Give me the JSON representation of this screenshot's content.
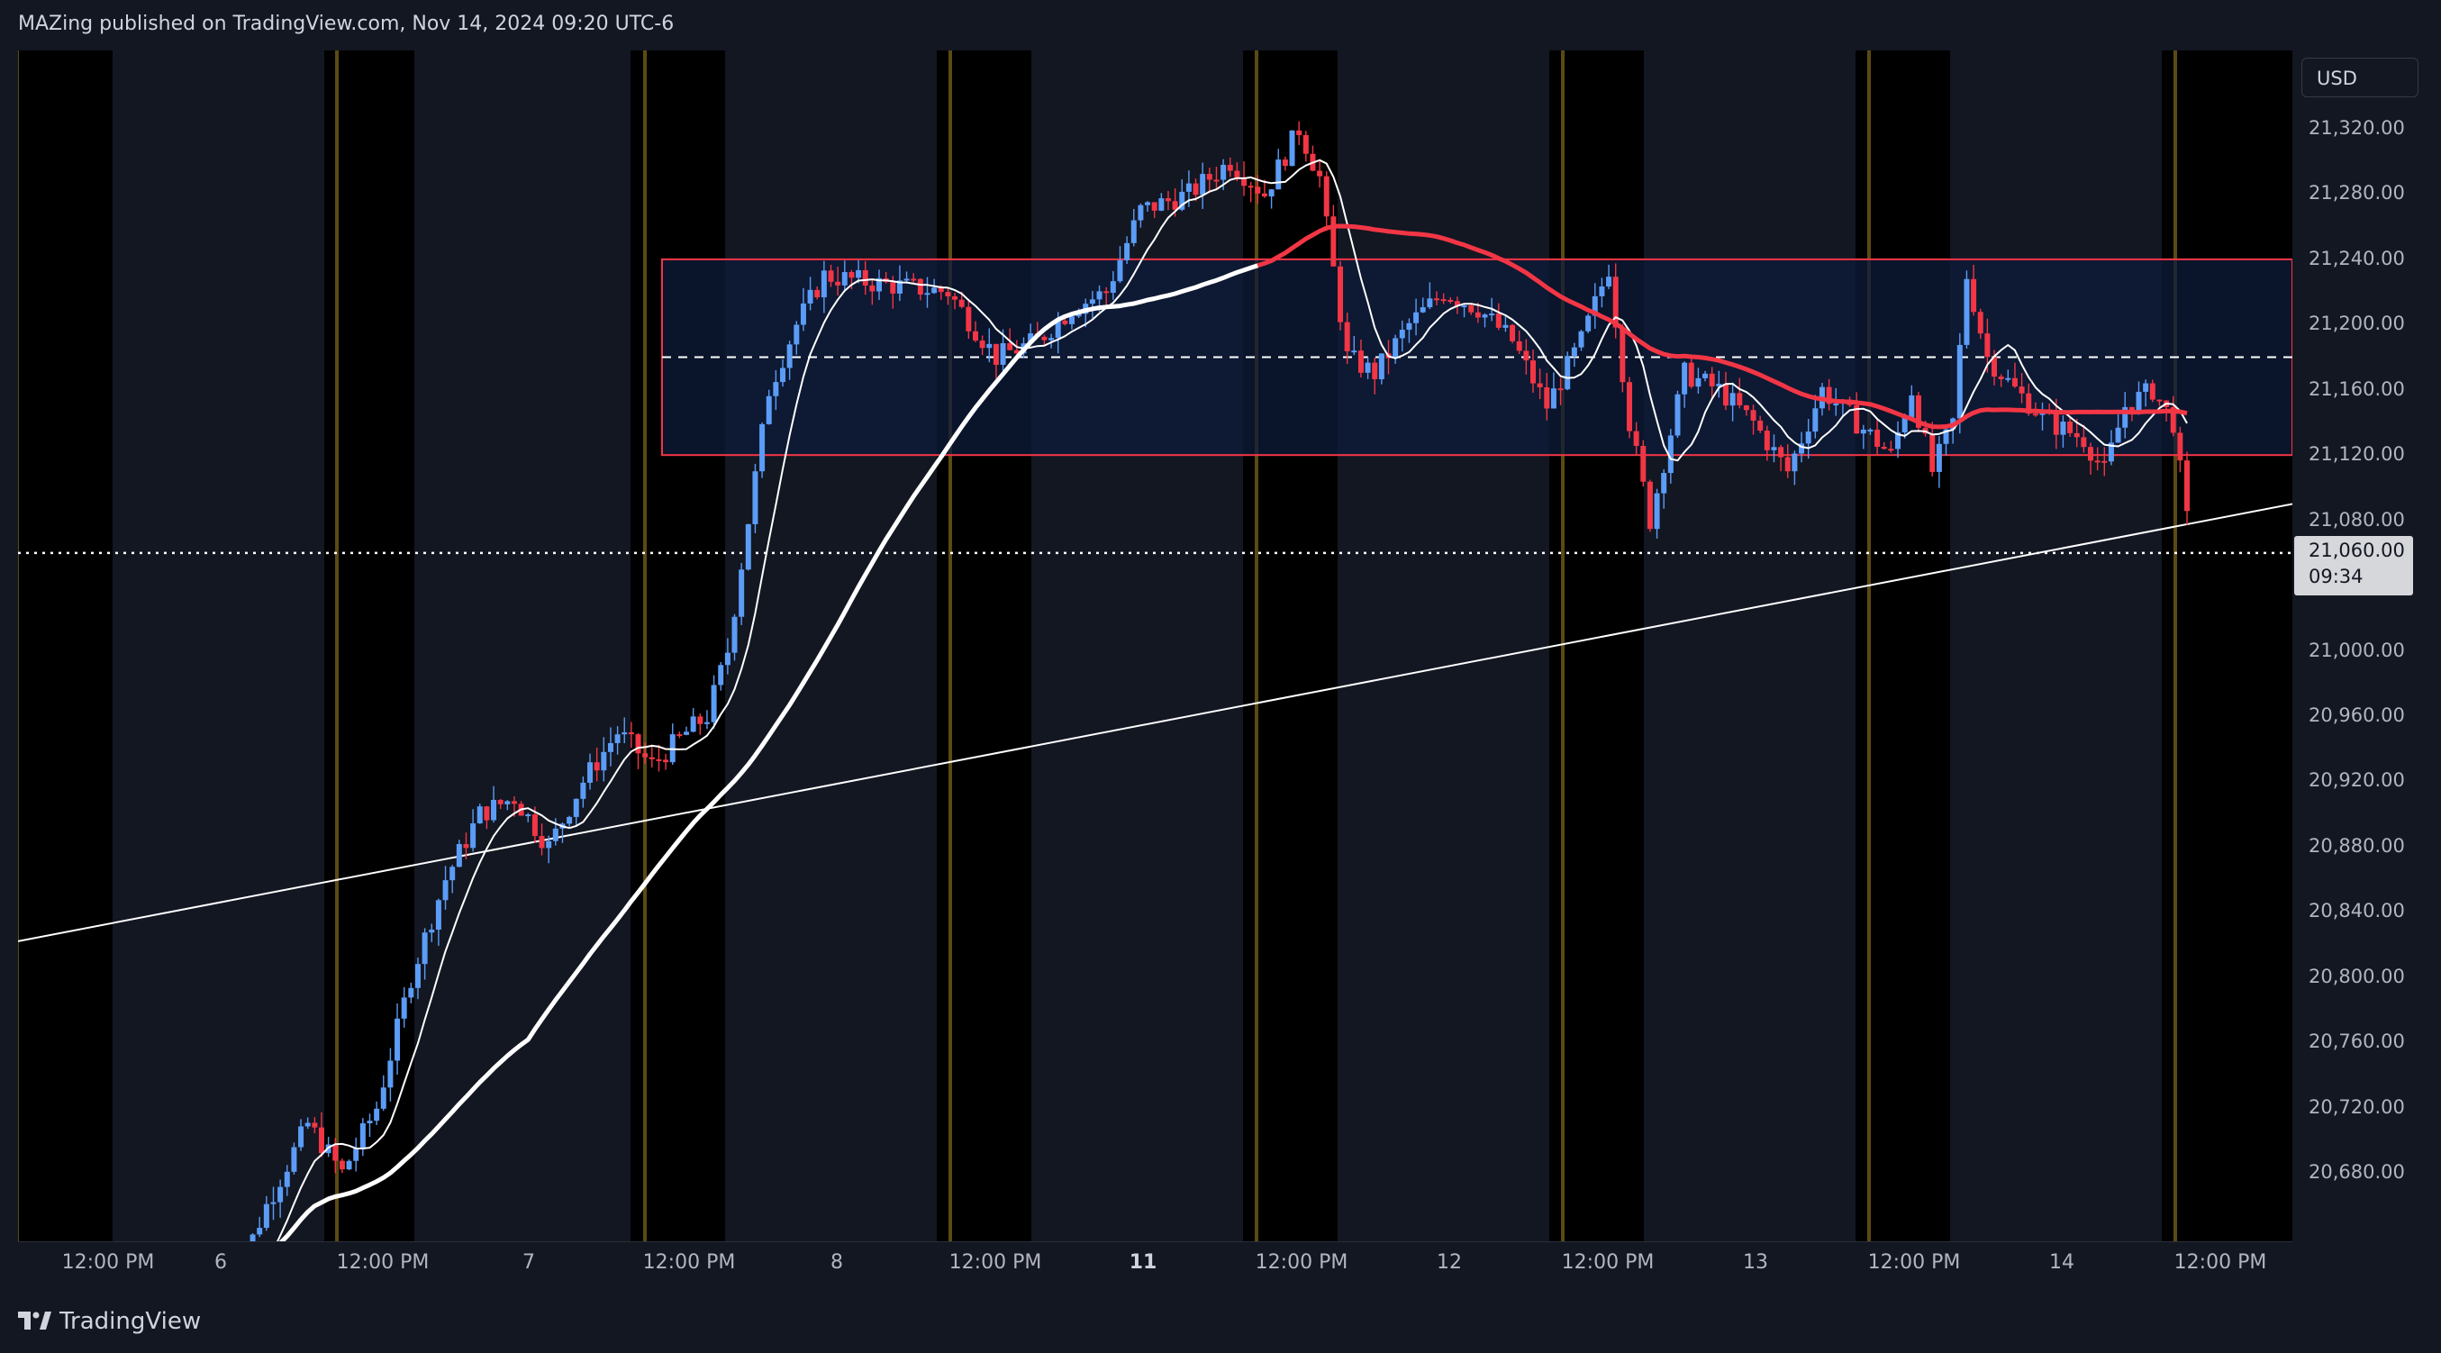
{
  "header": {
    "publisher_text": "MAZing published on TradingView.com, Nov 14, 2024 09:20 UTC-6"
  },
  "footer": {
    "logo_text": "TradingView"
  },
  "price_axis": {
    "currency": "USD"
  },
  "current_price": {
    "value": "21,060.00",
    "countdown": "09:34"
  },
  "colors": {
    "background": "#131722",
    "up": "#5b9cf6",
    "down": "#f23645",
    "ma_slow": "#ffffff",
    "ma_fast": "#ffffff",
    "ma_red": "#f23645",
    "box_fill": "#0d1b3a",
    "box_border": "#f23645",
    "session_line": "#5c4a14"
  },
  "chart_data": {
    "type": "candlestick",
    "symbol_timezone": "UTC-6",
    "y_ticks": [
      "21,320.00",
      "21,280.00",
      "21,240.00",
      "21,200.00",
      "21,160.00",
      "21,120.00",
      "21,080.00",
      "21,060.00",
      "21,000.00",
      "20,960.00",
      "20,920.00",
      "20,880.00",
      "20,840.00",
      "20,800.00",
      "20,760.00",
      "20,720.00",
      "20,680.00"
    ],
    "y_tick_values": [
      21320,
      21280,
      21240,
      21200,
      21160,
      21120,
      21080,
      21000,
      20960,
      20920,
      20880,
      20840,
      20800,
      20760,
      20720,
      20680
    ],
    "ylim": [
      20640,
      21365
    ],
    "x_ticks": [
      {
        "label": "12:00 PM",
        "bold": false
      },
      {
        "label": "6",
        "bold": false
      },
      {
        "label": "12:00 PM",
        "bold": false
      },
      {
        "label": "7",
        "bold": false
      },
      {
        "label": "12:00 PM",
        "bold": false
      },
      {
        "label": "8",
        "bold": false
      },
      {
        "label": "12:00 PM",
        "bold": false
      },
      {
        "label": "11",
        "bold": true
      },
      {
        "label": "12:00 PM",
        "bold": false
      },
      {
        "label": "12",
        "bold": false
      },
      {
        "label": "12:00 PM",
        "bold": false
      },
      {
        "label": "13",
        "bold": false
      },
      {
        "label": "12:00 PM",
        "bold": false
      },
      {
        "label": "14",
        "bold": false
      },
      {
        "label": "12:00 PM",
        "bold": false
      }
    ],
    "range_box": {
      "top": 21240,
      "bottom": 21120,
      "mid": 21180
    },
    "last_price": 21060,
    "trendline": {
      "from": 20822,
      "to": 21090
    },
    "close_path": [
      [
        0,
        20600
      ],
      [
        6,
        20660
      ],
      [
        12,
        20710
      ],
      [
        17,
        20680
      ],
      [
        22,
        20720
      ],
      [
        27,
        20800
      ],
      [
        32,
        20860
      ],
      [
        37,
        20900
      ],
      [
        42,
        20910
      ],
      [
        47,
        20880
      ],
      [
        52,
        20920
      ],
      [
        57,
        20950
      ],
      [
        62,
        20930
      ],
      [
        67,
        20950
      ],
      [
        70,
        20960
      ],
      [
        73,
        21000
      ],
      [
        76,
        21080
      ],
      [
        79,
        21160
      ],
      [
        83,
        21200
      ],
      [
        87,
        21230
      ],
      [
        95,
        21225
      ],
      [
        105,
        21220
      ],
      [
        112,
        21180
      ],
      [
        118,
        21190
      ],
      [
        123,
        21210
      ],
      [
        128,
        21220
      ],
      [
        133,
        21270
      ],
      [
        140,
        21280
      ],
      [
        146,
        21300
      ],
      [
        151,
        21280
      ],
      [
        156,
        21320
      ],
      [
        159,
        21290
      ],
      [
        160,
        21260
      ],
      [
        163,
        21180
      ],
      [
        167,
        21170
      ],
      [
        172,
        21200
      ],
      [
        177,
        21220
      ],
      [
        182,
        21210
      ],
      [
        187,
        21190
      ],
      [
        192,
        21150
      ],
      [
        197,
        21190
      ],
      [
        201,
        21235
      ],
      [
        204,
        21140
      ],
      [
        207,
        21080
      ],
      [
        212,
        21170
      ],
      [
        217,
        21160
      ],
      [
        222,
        21140
      ],
      [
        227,
        21110
      ],
      [
        232,
        21160
      ],
      [
        237,
        21140
      ],
      [
        242,
        21120
      ],
      [
        245,
        21160
      ],
      [
        248,
        21110
      ],
      [
        251,
        21140
      ],
      [
        253,
        21230
      ],
      [
        256,
        21180
      ],
      [
        260,
        21160
      ],
      [
        265,
        21140
      ],
      [
        270,
        21130
      ],
      [
        273,
        21110
      ],
      [
        276,
        21150
      ],
      [
        280,
        21160
      ],
      [
        283,
        21140
      ],
      [
        285,
        21080
      ]
    ]
  }
}
